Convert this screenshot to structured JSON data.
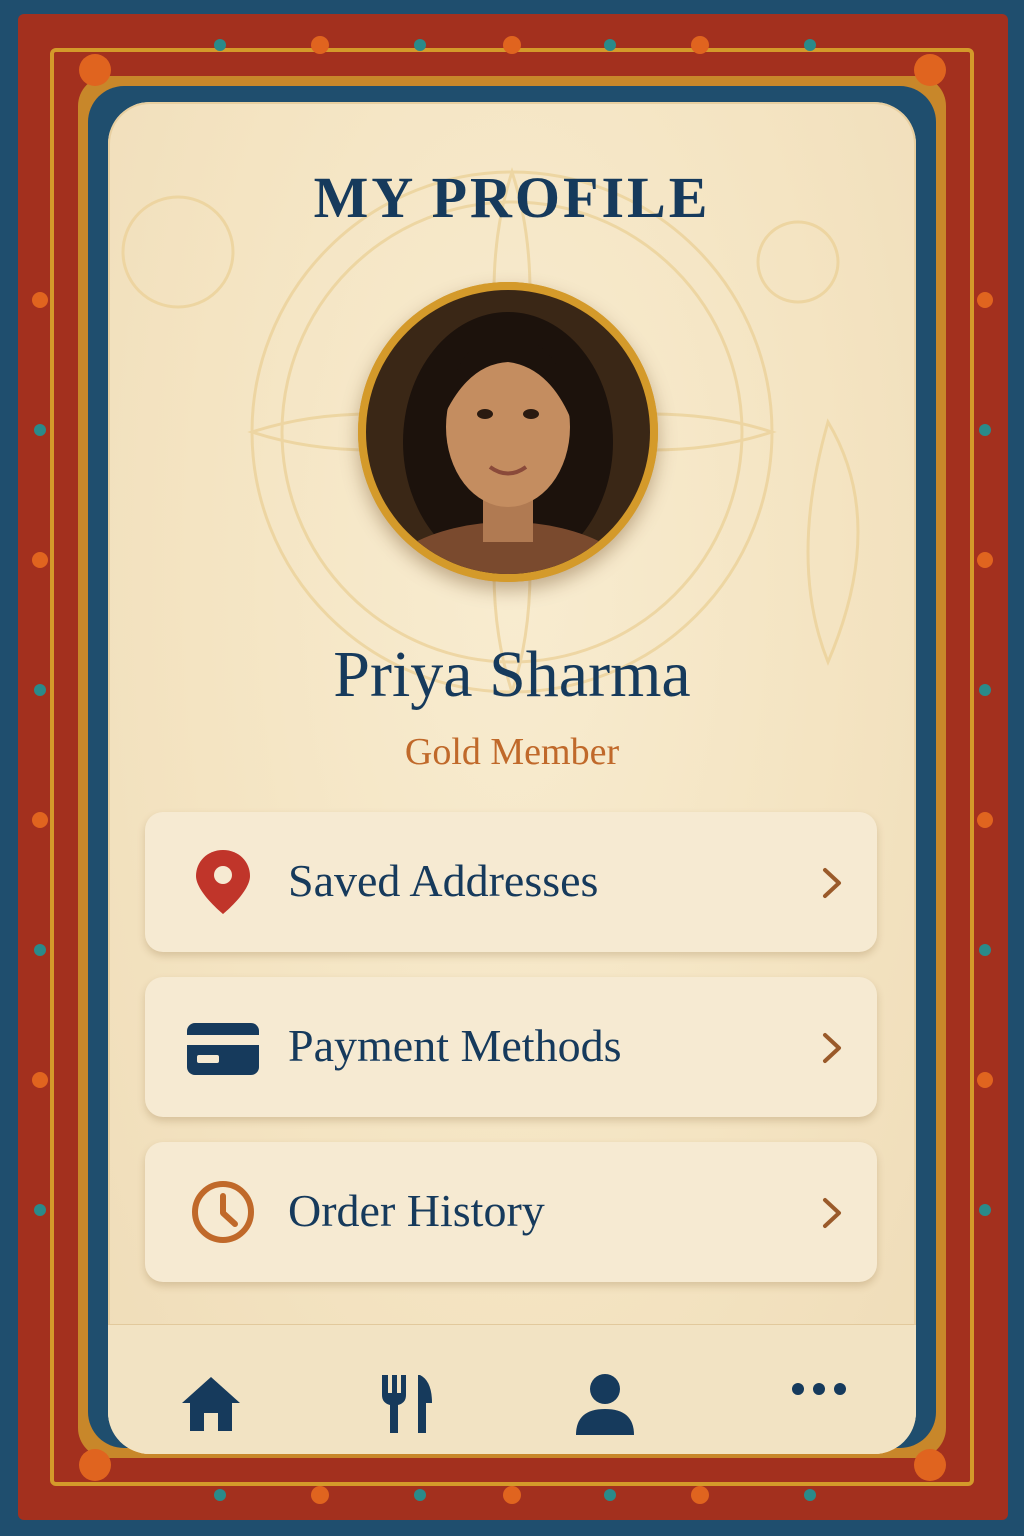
{
  "header": {
    "title": "MY PROFILE"
  },
  "profile": {
    "name": "Priya Sharma",
    "tier": "Gold Member",
    "avatar_icon": "profile-photo"
  },
  "menu": [
    {
      "label": "Saved Addresses",
      "icon": "location-pin-icon",
      "icon_color": "#c0352a"
    },
    {
      "label": "Payment Methods",
      "icon": "credit-card-icon",
      "icon_color": "#163a5c"
    },
    {
      "label": "Order History",
      "icon": "clock-icon",
      "icon_color": "#c0692a"
    }
  ],
  "bottom_nav": [
    {
      "icon": "home-icon"
    },
    {
      "icon": "fork-knife-icon"
    },
    {
      "icon": "user-icon"
    },
    {
      "icon": "more-icon"
    }
  ],
  "colors": {
    "navy": "#163a5c",
    "accent_orange": "#c0692a",
    "gold": "#d49a2a",
    "border_red": "#a3301e",
    "border_blue": "#1f4e6e",
    "card_bg": "#f4e4c2"
  }
}
